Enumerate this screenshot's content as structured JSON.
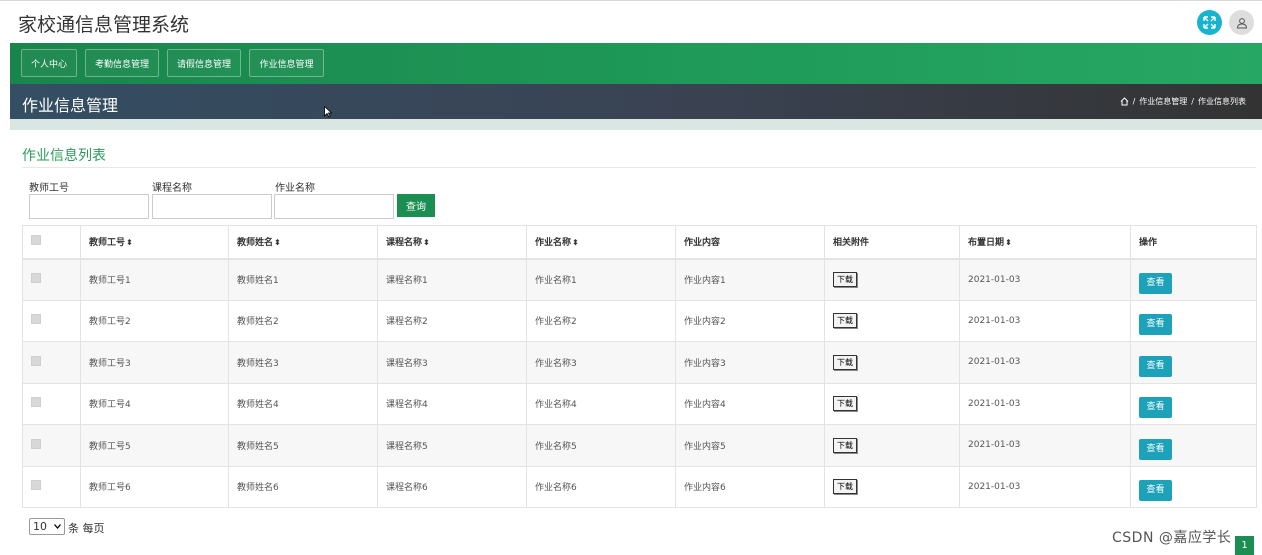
{
  "app": {
    "title": "家校通信息管理系统"
  },
  "nav": {
    "items": [
      {
        "label": "个人中心"
      },
      {
        "label": "考勤信息管理"
      },
      {
        "label": "请假信息管理"
      },
      {
        "label": "作业信息管理"
      }
    ]
  },
  "header": {
    "title": "作业信息管理",
    "breadcrumb": {
      "sep": "/",
      "item1": "作业信息管理",
      "item2": "作业信息列表"
    }
  },
  "list": {
    "title": "作业信息列表",
    "filters": {
      "teacher_id_label": "教师工号",
      "course_label": "课程名称",
      "homework_label": "作业名称",
      "query_label": "查询"
    },
    "columns": [
      "教师工号",
      "教师姓名",
      "课程名称",
      "作业名称",
      "作业内容",
      "相关附件",
      "布置日期",
      "操作"
    ],
    "sort_icon": "⬍",
    "download_label": "下载",
    "view_label": "查看",
    "rows": [
      {
        "teacher_id": "教师工号1",
        "teacher_name": "教师姓名1",
        "course": "课程名称1",
        "homework": "作业名称1",
        "content": "作业内容1",
        "date": "2021-01-03"
      },
      {
        "teacher_id": "教师工号2",
        "teacher_name": "教师姓名2",
        "course": "课程名称2",
        "homework": "作业名称2",
        "content": "作业内容2",
        "date": "2021-01-03"
      },
      {
        "teacher_id": "教师工号3",
        "teacher_name": "教师姓名3",
        "course": "课程名称3",
        "homework": "作业名称3",
        "content": "作业内容3",
        "date": "2021-01-03"
      },
      {
        "teacher_id": "教师工号4",
        "teacher_name": "教师姓名4",
        "course": "课程名称4",
        "homework": "作业名称4",
        "content": "作业内容4",
        "date": "2021-01-03"
      },
      {
        "teacher_id": "教师工号5",
        "teacher_name": "教师姓名5",
        "course": "课程名称5",
        "homework": "作业名称5",
        "content": "作业内容5",
        "date": "2021-01-03"
      },
      {
        "teacher_id": "教师工号6",
        "teacher_name": "教师姓名6",
        "course": "课程名称6",
        "homework": "作业名称6",
        "content": "作业内容6",
        "date": "2021-01-03"
      }
    ]
  },
  "pager": {
    "page_size": "10",
    "per_page_text": "条 每页",
    "current_page": "1"
  },
  "watermark": "CSDN @嘉应学长",
  "icons": {
    "expand": "expand-icon",
    "user": "user-icon",
    "home": "home-icon",
    "checkbox": "checkbox-icon",
    "sort": "sort-icon"
  },
  "colors": {
    "nav_green": "#1f9a58",
    "query_green": "#1c8e52",
    "view_teal": "#1da2ba",
    "title_green": "#2c9a5c",
    "header_dark": "#3a4252"
  }
}
